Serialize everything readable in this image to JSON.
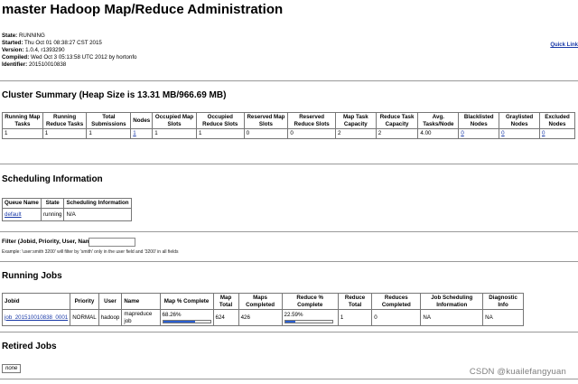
{
  "title": "master Hadoop Map/Reduce Administration",
  "info": [
    {
      "label": "State:",
      "value": "RUNNING"
    },
    {
      "label": "Started:",
      "value": "Thu Oct 01 08:38:27 CST 2015"
    },
    {
      "label": "Version:",
      "value": "1.0.4, r1393290"
    },
    {
      "label": "Compiled:",
      "value": "Wed Oct 3 05:13:58 UTC 2012 by hortonfo"
    },
    {
      "label": "Identifier:",
      "value": "201510010838"
    }
  ],
  "quick_links": "Quick Link",
  "cluster_summary": {
    "heading": "Cluster Summary (Heap Size is 13.31 MB/966.69 MB)",
    "headers": [
      "Running Map Tasks",
      "Running Reduce Tasks",
      "Total Submissions",
      "Nodes",
      "Occupied Map Slots",
      "Occupied Reduce Slots",
      "Reserved Map Slots",
      "Reserved Reduce Slots",
      "Map Task Capacity",
      "Reduce Task Capacity",
      "Avg. Tasks/Node",
      "Blacklisted Nodes",
      "Graylisted Nodes",
      "Excluded Nodes"
    ],
    "values": [
      "1",
      "1",
      "1",
      "1",
      "1",
      "1",
      "0",
      "0",
      "2",
      "2",
      "4.00",
      "0",
      "0",
      "0"
    ]
  },
  "scheduling": {
    "heading": "Scheduling Information",
    "headers": [
      "Queue Name",
      "State",
      "Scheduling Information"
    ],
    "row": {
      "queue": "default",
      "state": "running",
      "info": "N/A"
    }
  },
  "filter": {
    "label": "Filter (Jobid, Priority, User, Name)",
    "value": "",
    "example": "Example: 'user:smith 3200' will filter by 'smith' only in the user field and '3200' in all fields"
  },
  "running_jobs": {
    "heading": "Running Jobs",
    "headers": [
      "Jobid",
      "Priority",
      "User",
      "Name",
      "Map % Complete",
      "Map Total",
      "Maps Completed",
      "Reduce % Complete",
      "Reduce Total",
      "Reduces Completed",
      "Job Scheduling Information",
      "Diagnostic Info"
    ],
    "row": {
      "jobid": "job_201510010838_0001",
      "priority": "NORMAL",
      "user": "hadoop",
      "name": "mapreduce job",
      "map_pct": "68.26%",
      "map_fraction": 0.6826,
      "map_total": "624",
      "maps_completed": "426",
      "reduce_pct": "22.59%",
      "reduce_fraction": 0.2259,
      "reduce_total": "1",
      "reduces_completed": "0",
      "sched_info": "NA",
      "diag_info": "NA"
    }
  },
  "retired_jobs": {
    "heading": "Retired Jobs",
    "none_label": "none"
  },
  "watermark": "CSDN @kuailefangyuan",
  "colors": {
    "link": "#1a3aa8",
    "progress": "#2b5fd0"
  }
}
